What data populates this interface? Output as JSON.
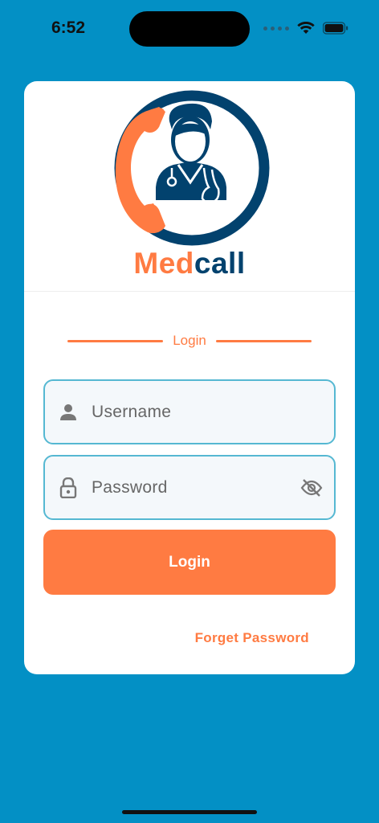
{
  "status_bar": {
    "time": "6:52"
  },
  "brand": {
    "name_part1": "Med",
    "name_part2": "call",
    "color_primary": "#FF7B42",
    "color_secondary": "#02426E"
  },
  "login_section": {
    "title": "Login"
  },
  "username_field": {
    "placeholder": "Username",
    "value": "",
    "icon": "person-icon"
  },
  "password_field": {
    "placeholder": "Password",
    "value": "",
    "icon": "lock-icon",
    "toggle_icon": "eye-off-icon"
  },
  "login_button": {
    "label": "Login"
  },
  "forget_password": {
    "label": "Forget Password"
  },
  "colors": {
    "background": "#0390C5",
    "accent": "#FF7B42",
    "field_border": "#55B8D2"
  }
}
